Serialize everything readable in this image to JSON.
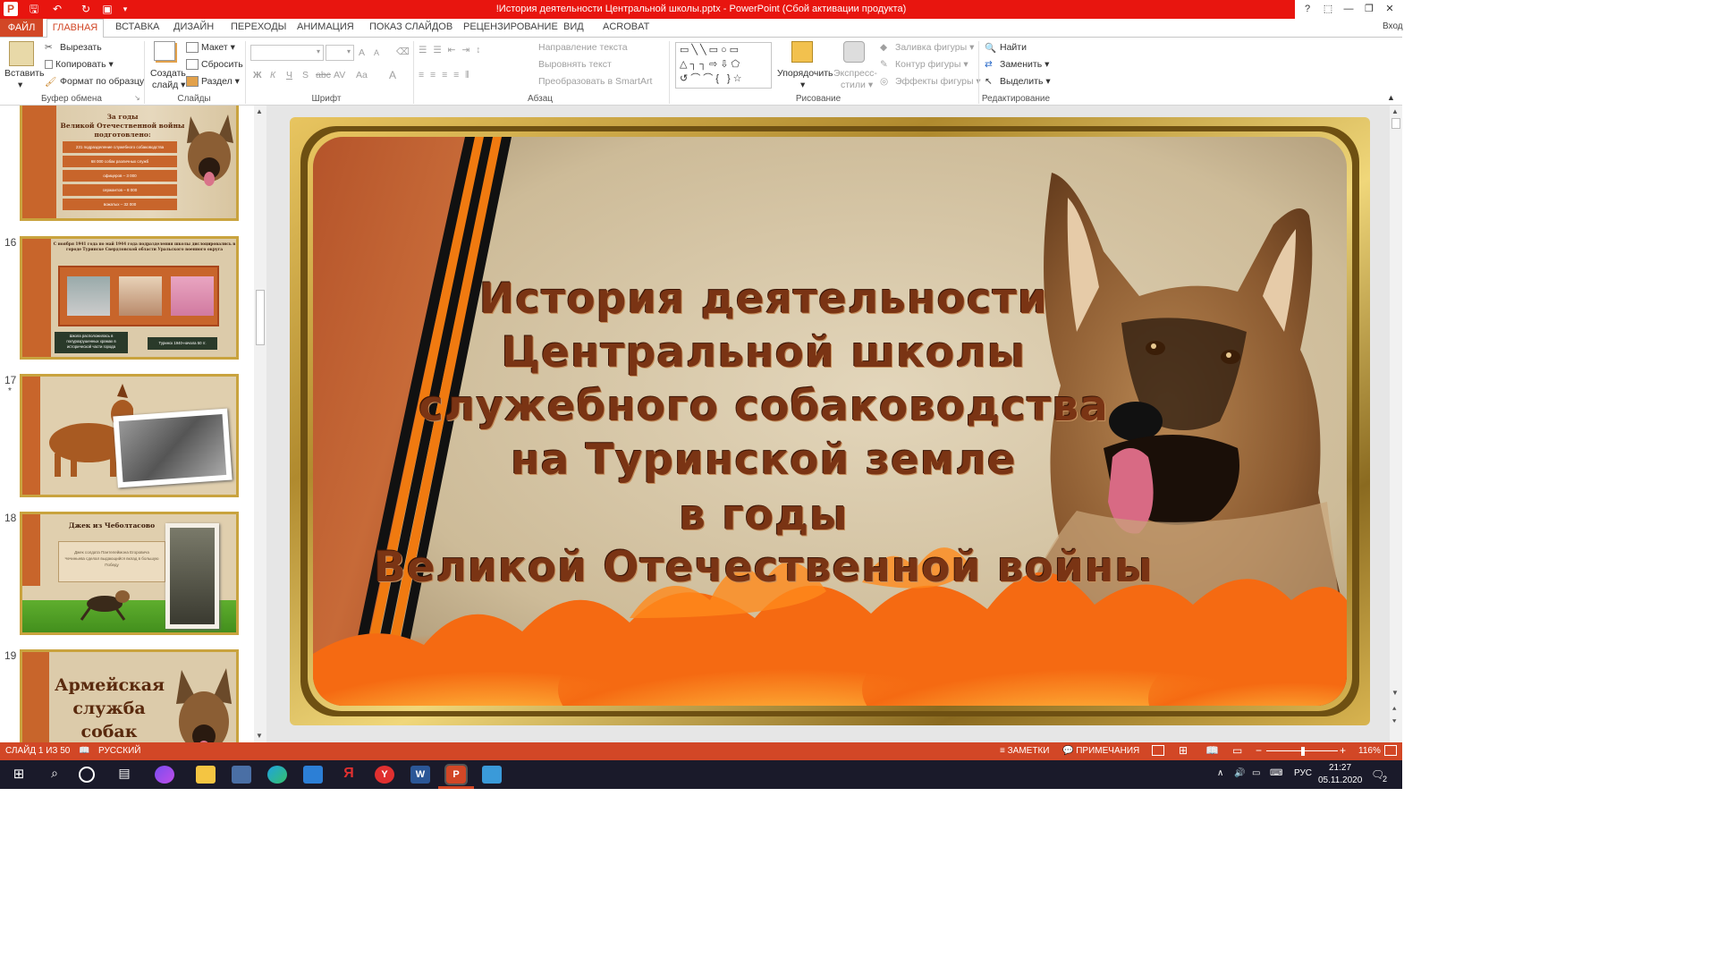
{
  "window": {
    "title": "!История деятельности Центральной школы.pptx - PowerPoint (Сбой активации продукта)",
    "login": "Вход",
    "help": "?"
  },
  "tabs": [
    "ФАЙЛ",
    "ГЛАВНАЯ",
    "ВСТАВКА",
    "ДИЗАЙН",
    "ПЕРЕХОДЫ",
    "АНИМАЦИЯ",
    "ПОКАЗ СЛАЙДОВ",
    "РЕЦЕНЗИРОВАНИЕ",
    "ВИД",
    "ACROBAT"
  ],
  "ribbon": {
    "clipboard": {
      "paste": "Вставить",
      "cut": "Вырезать",
      "copy": "Копировать",
      "format": "Формат по образцу",
      "group": "Буфер обмена"
    },
    "slides": {
      "create": "Создать",
      "create2": "слайд",
      "layout": "Макет",
      "reset": "Сбросить",
      "section": "Раздел",
      "group": "Слайды"
    },
    "font": {
      "bold": "Ж",
      "italic": "К",
      "underline": "Ч",
      "strike": "S",
      "abc": "abc",
      "av": "AV",
      "aa": "Aa",
      "a": "A",
      "grow": "A",
      "shrink": "A",
      "group": "Шрифт"
    },
    "paragraph": {
      "direction": "Направление текста",
      "align": "Выровнять текст",
      "smartart": "Преобразовать в SmartArt",
      "group": "Абзац"
    },
    "drawing": {
      "arrange": "Упорядочить",
      "quick": "Экспресс-",
      "quick2": "стили",
      "fill": "Заливка фигуры",
      "outline": "Контур фигуры",
      "effects": "Эффекты фигуры",
      "group": "Рисование"
    },
    "editing": {
      "find": "Найти",
      "replace": "Заменить",
      "select": "Выделить",
      "group": "Редактирование"
    }
  },
  "thumbnails": [
    {
      "num": "",
      "title1": "За годы",
      "title2": "Великой Отечественной войны",
      "title3": "подготовлено:",
      "rows": [
        "231 подразделение служебного собаководства",
        "68 000 собак различных служб",
        "офицеров – 3 000",
        "сержантов – 8 000",
        "вожатых – 32 000"
      ]
    },
    {
      "num": "16",
      "text": "С ноября 1941 года по май 1944 года подразделения школы дислоцировались в городе Туринске Свердловской области Уральского военного округа",
      "cap1": "Школа расположилась в полуразрушенных храмах в исторической части города",
      "cap2": "Туринск 1940-начала 50 гг."
    },
    {
      "num": "17",
      "star": "*"
    },
    {
      "num": "18",
      "title": "Джек из Чеболтасово",
      "text": "Джек солдата Пантелеймона Егоровича Чечиньева сделал выдающийся вклад в большую Победу"
    },
    {
      "num": "19",
      "text": "Армейская служба собак"
    }
  ],
  "slide": {
    "lines": [
      "История деятельности",
      "Центральной школы",
      "служебного собаководства",
      "на Туринской земле",
      "в годы",
      "Великой Отечественной войны"
    ]
  },
  "status": {
    "slide": "СЛАЙД 1 ИЗ 50",
    "lang": "РУССКИЙ",
    "notes": "ЗАМЕТКИ",
    "comments": "ПРИМЕЧАНИЯ",
    "zoom": "116%"
  },
  "tray": {
    "lang": "РУС",
    "time": "21:27",
    "date": "05.11.2020",
    "notif": "2"
  }
}
